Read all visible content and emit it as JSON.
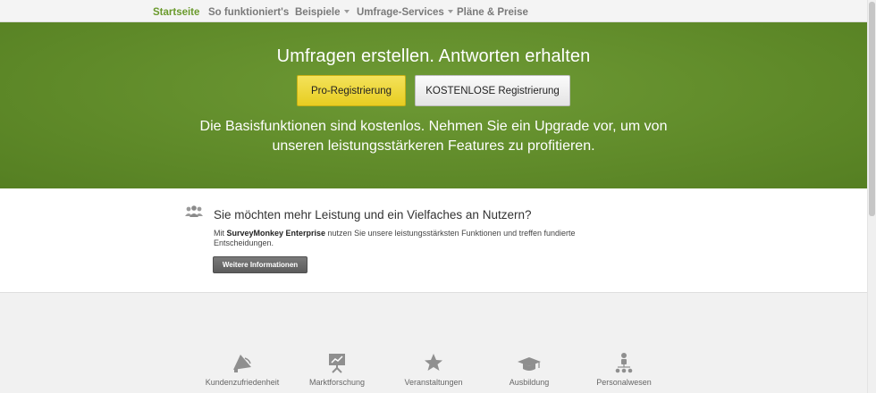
{
  "nav": {
    "items": [
      {
        "label": "Startseite",
        "active": true,
        "dropdown": false
      },
      {
        "label": "So funktioniert's",
        "active": false,
        "dropdown": false
      },
      {
        "label": "Beispiele",
        "active": false,
        "dropdown": true
      },
      {
        "label": "Umfrage-Services",
        "active": false,
        "dropdown": true
      },
      {
        "label": "Pläne & Preise",
        "active": false,
        "dropdown": false
      }
    ]
  },
  "hero": {
    "title": "Umfragen erstellen. Antworten erhalten",
    "pro_button": "Pro-Registrierung",
    "free_button": "KOSTENLOSE Registrierung",
    "subtitle_line1": "Die Basisfunktionen sind kostenlos. Nehmen Sie ein Upgrade vor, um von",
    "subtitle_line2": "unseren leistungsstärkeren Features zu profitieren."
  },
  "enterprise": {
    "title": "Sie möchten mehr Leistung und ein Vielfaches an Nutzern?",
    "text_prefix": "Mit ",
    "text_bold": "SurveyMonkey Enterprise",
    "text_rest": " nutzen Sie unsere leistungsstärksten Funktionen und treffen fundierte Entscheidungen.",
    "button": "Weitere Informationen"
  },
  "categories": [
    {
      "label": "Kundenzufriedenheit",
      "icon": "megaphone-icon"
    },
    {
      "label": "Marktforschung",
      "icon": "presentation-chart-icon"
    },
    {
      "label": "Veranstaltungen",
      "icon": "star-icon"
    },
    {
      "label": "Ausbildung",
      "icon": "graduation-cap-icon"
    },
    {
      "label": "Personalwesen",
      "icon": "org-chart-icon"
    }
  ],
  "colors": {
    "brand_green": "#5f8a29",
    "nav_active": "#6a9a2c",
    "pro_yellow": "#e7cd21"
  }
}
